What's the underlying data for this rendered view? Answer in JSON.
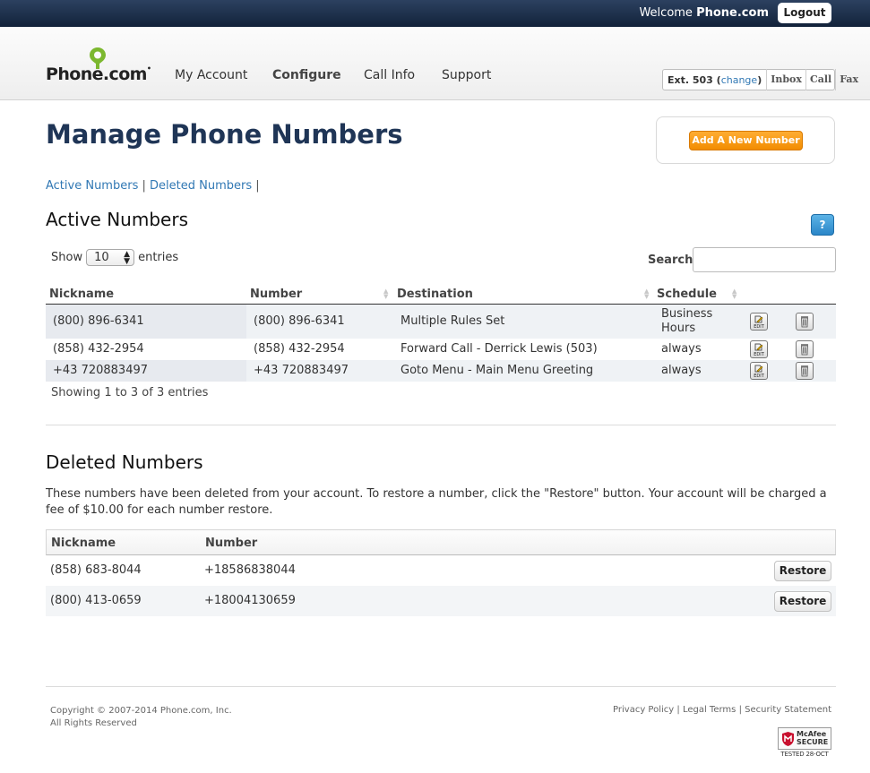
{
  "topbar": {
    "welcome_prefix": "Welcome",
    "welcome_name": "Phone.com",
    "logout_label": "Logout"
  },
  "header": {
    "logo_text": "Phone.com",
    "logo_mark": "•",
    "nav": [
      {
        "label": "My Account"
      },
      {
        "label": "Configure"
      },
      {
        "label": "Call Info"
      },
      {
        "label": "Support"
      }
    ],
    "ext": {
      "label": "Ext. 503",
      "change_label": "change",
      "links": [
        "Inbox",
        "Call",
        "Fax"
      ]
    }
  },
  "page": {
    "title": "Manage Phone Numbers",
    "add_button": "Add A New Number",
    "subnav": {
      "active": "Active Numbers",
      "deleted": "Deleted Numbers",
      "separator": "|"
    }
  },
  "active": {
    "title": "Active Numbers",
    "help_label": "?",
    "show_label": "Show",
    "entries_label": "entries",
    "page_size": "10",
    "search_label": "Search:",
    "search_value": "",
    "columns": [
      "Nickname",
      "Number",
      "Destination",
      "Schedule"
    ],
    "rows": [
      {
        "nickname": "(800) 896-6341",
        "number": "(800) 896-6341",
        "destination": "Multiple Rules Set",
        "schedule_line1": "Business",
        "schedule_line2": "Hours"
      },
      {
        "nickname": "(858) 432-2954",
        "number": "(858) 432-2954",
        "destination": "Forward Call - Derrick Lewis (503)",
        "schedule_line1": "always",
        "schedule_line2": ""
      },
      {
        "nickname": "+43 720883497",
        "number": "+43 720883497",
        "destination": "Goto Menu - Main Menu Greeting",
        "schedule_line1": "always",
        "schedule_line2": ""
      }
    ],
    "edit_icon_text": "EDIT",
    "showing_text": "Showing 1 to 3 of 3 entries"
  },
  "deleted": {
    "title": "Deleted Numbers",
    "description": "These numbers have been deleted from your account. To restore a number, click the \"Restore\" button. Your account will be charged a fee of $10.00 for each number restore.",
    "columns": [
      "Nickname",
      "Number"
    ],
    "rows": [
      {
        "nickname": "(858) 683-8044",
        "number": "+18586838044",
        "action": "Restore"
      },
      {
        "nickname": "(800) 413-0659",
        "number": "+18004130659",
        "action": "Restore"
      }
    ]
  },
  "footer": {
    "copyright_line1": "Copyright © 2007-2014 Phone.com, Inc.",
    "copyright_line2": "All Rights Reserved",
    "links": [
      "Privacy Policy",
      "Legal Terms",
      "Security Statement"
    ],
    "link_separator": "|",
    "mcafee_line1": "McAfee",
    "mcafee_line2": "SECURE",
    "mcafee_tested": "TESTED 28-OCT"
  },
  "colors": {
    "brand_navy": "#1f3556",
    "link_blue": "#3178b4",
    "accent_orange": "#f28c00",
    "logo_green": "#7cb82f"
  }
}
